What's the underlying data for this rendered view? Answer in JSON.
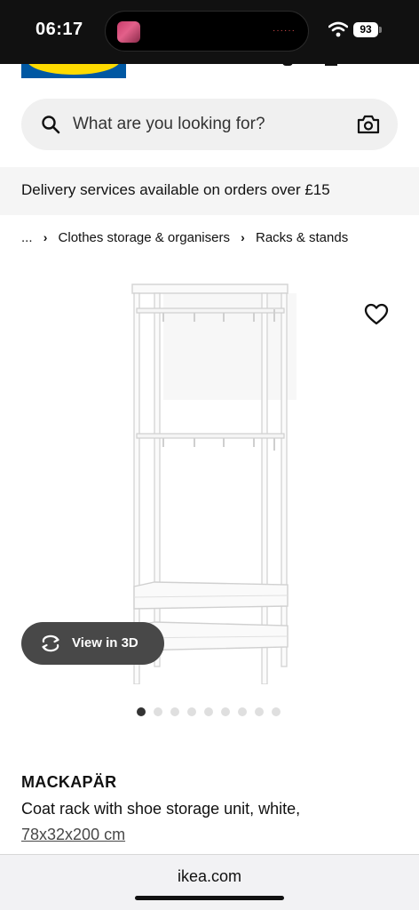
{
  "status_bar": {
    "time": "06:17",
    "battery": "93"
  },
  "search": {
    "placeholder": "What are you looking for?"
  },
  "banner": {
    "text": "Delivery services available on orders over £15"
  },
  "breadcrumb": {
    "items": [
      "...",
      "Clothes storage & organisers",
      "Racks & stands"
    ]
  },
  "product": {
    "name": "MACKAPÄR",
    "description": "Coat rack with shoe storage unit, white,",
    "size": "78x32x200 cm",
    "image_icon": "coat-rack-product-image"
  },
  "viewer": {
    "view_3d_label": "View in 3D"
  },
  "carousel": {
    "total": 9,
    "active": 1
  },
  "browser": {
    "url": "ikea.com"
  },
  "colors": {
    "brand_blue": "#0058a3",
    "brand_yellow": "#ffdb00",
    "button_dark": "#484848"
  }
}
